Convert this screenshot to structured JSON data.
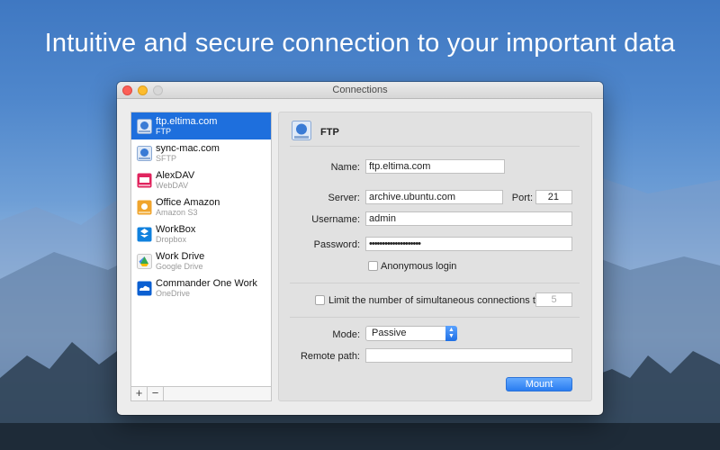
{
  "headline": "Intuitive and secure connection to your important data",
  "window": {
    "title": "Connections"
  },
  "connections": [
    {
      "name": "ftp.eltima.com",
      "type": "FTP",
      "icon": "ftp-icon",
      "color": "#3a7bd5",
      "selected": true
    },
    {
      "name": "sync-mac.com",
      "type": "SFTP",
      "icon": "sftp-icon",
      "color": "#3a7bd5",
      "selected": false
    },
    {
      "name": "AlexDAV",
      "type": "WebDAV",
      "icon": "webdav-icon",
      "color": "#e0245e",
      "selected": false
    },
    {
      "name": "Office Amazon",
      "type": "Amazon S3",
      "icon": "amazon-s3-icon",
      "color": "#e8a33a",
      "selected": false
    },
    {
      "name": "WorkBox",
      "type": "Dropbox",
      "icon": "dropbox-icon",
      "color": "#1081de",
      "selected": false
    },
    {
      "name": "Work Drive",
      "type": "Google Drive",
      "icon": "google-drive-icon",
      "color": "#34a853",
      "selected": false
    },
    {
      "name": "Commander One Work",
      "type": "OneDrive",
      "icon": "onedrive-icon",
      "color": "#0a5fd1",
      "selected": false
    }
  ],
  "sidebar_footer": {
    "add": "+",
    "remove": "−"
  },
  "panel": {
    "title": "FTP",
    "name_label": "Name:",
    "name_value": "ftp.eltima.com",
    "server_label": "Server:",
    "server_value": "archive.ubuntu.com",
    "port_label": "Port:",
    "port_value": "21",
    "username_label": "Username:",
    "username_value": "admin",
    "password_label": "Password:",
    "password_value": "••••••••••••••••••••",
    "anonymous_label": "Anonymous login",
    "limit_label": "Limit the number of simultaneous connections to",
    "limit_value": "5",
    "mode_label": "Mode:",
    "mode_value": "Passive",
    "remote_path_label": "Remote path:",
    "remote_path_value": "",
    "mount_label": "Mount"
  },
  "colors": {
    "accent": "#1e6fdd",
    "close": "#fc5f57",
    "minimize": "#fdbc2e"
  }
}
